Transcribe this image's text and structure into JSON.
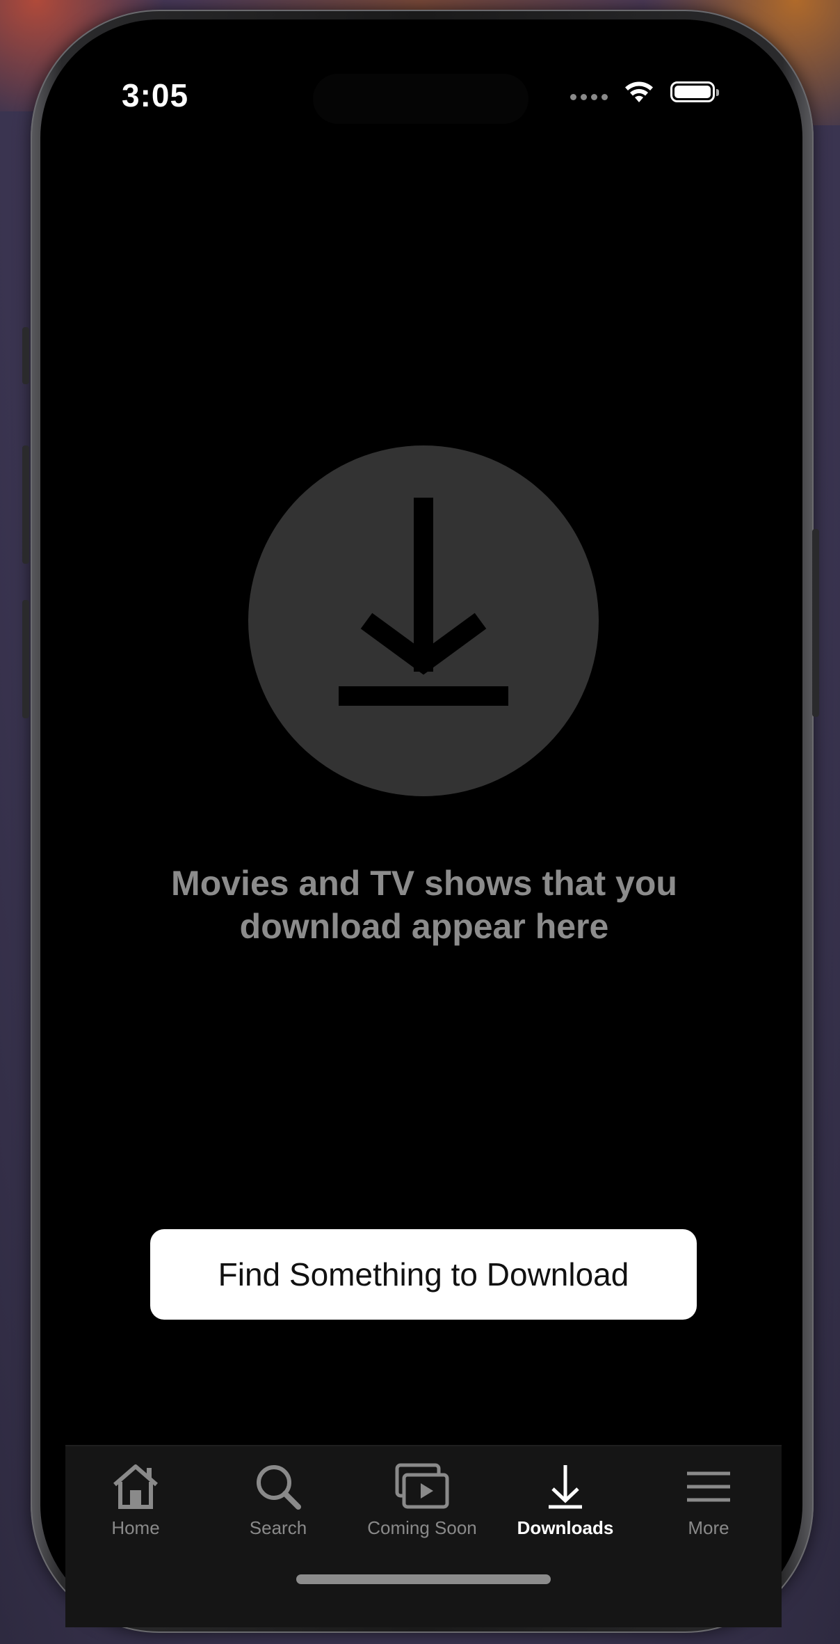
{
  "status_bar": {
    "time": "3:05"
  },
  "empty_state": {
    "icon": "download-icon",
    "message": "Movies and TV shows that you download appear here"
  },
  "actions": {
    "find_button_label": "Find Something to Download"
  },
  "tab_bar": {
    "active": "Downloads",
    "tabs": [
      {
        "label": "Home",
        "icon": "home-icon"
      },
      {
        "label": "Search",
        "icon": "search-icon"
      },
      {
        "label": "Coming Soon",
        "icon": "coming-soon-icon"
      },
      {
        "label": "Downloads",
        "icon": "download-icon"
      },
      {
        "label": "More",
        "icon": "menu-icon"
      }
    ]
  },
  "colors": {
    "background": "#000000",
    "circle": "#333333",
    "message_text": "#8c8c8c",
    "button_bg": "#ffffff",
    "tab_inactive": "#8a8a8a",
    "tab_active": "#ffffff"
  }
}
